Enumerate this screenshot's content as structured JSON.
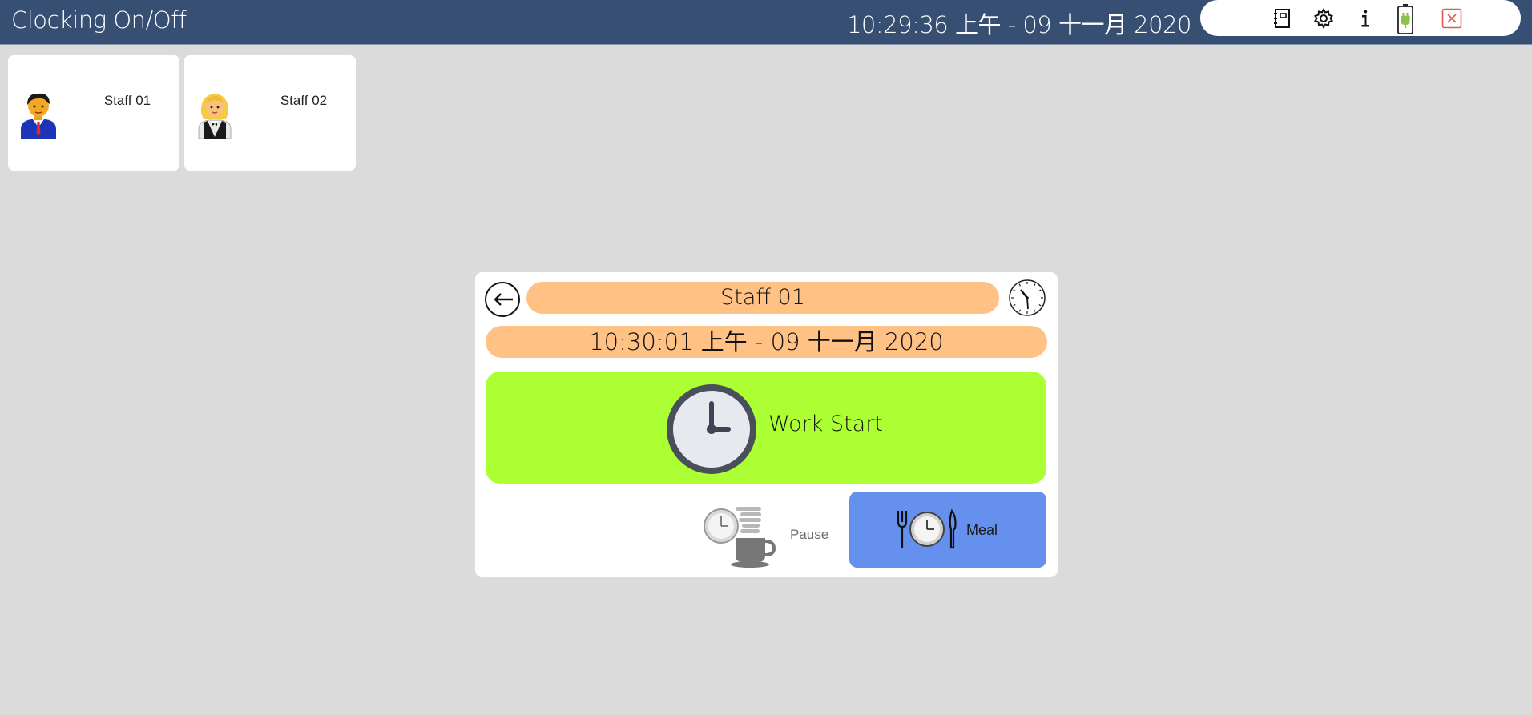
{
  "header": {
    "title": "Clocking On/Off",
    "datetime": "10:29:36 上午 - 09 十一月 2020"
  },
  "tray": {
    "icons": [
      "notebook-icon",
      "gear-icon",
      "info-icon",
      "battery-charging-icon",
      "close-icon"
    ]
  },
  "staff": [
    {
      "name": "Staff 01",
      "avatar": "male-staff-avatar"
    },
    {
      "name": "Staff 02",
      "avatar": "female-staff-avatar"
    }
  ],
  "dialog": {
    "staff_name": "Staff 01",
    "datetime": "10:30:01 上午 - 09 十一月 2020",
    "work_start_label": "Work Start",
    "pause_label": "Pause",
    "meal_label": "Meal"
  },
  "colors": {
    "topbar": "#364f72",
    "pill": "#ffc184",
    "work_start": "#acff32",
    "meal": "#6690ee",
    "close": "#e05a4e",
    "battery": "#8bc34a"
  }
}
